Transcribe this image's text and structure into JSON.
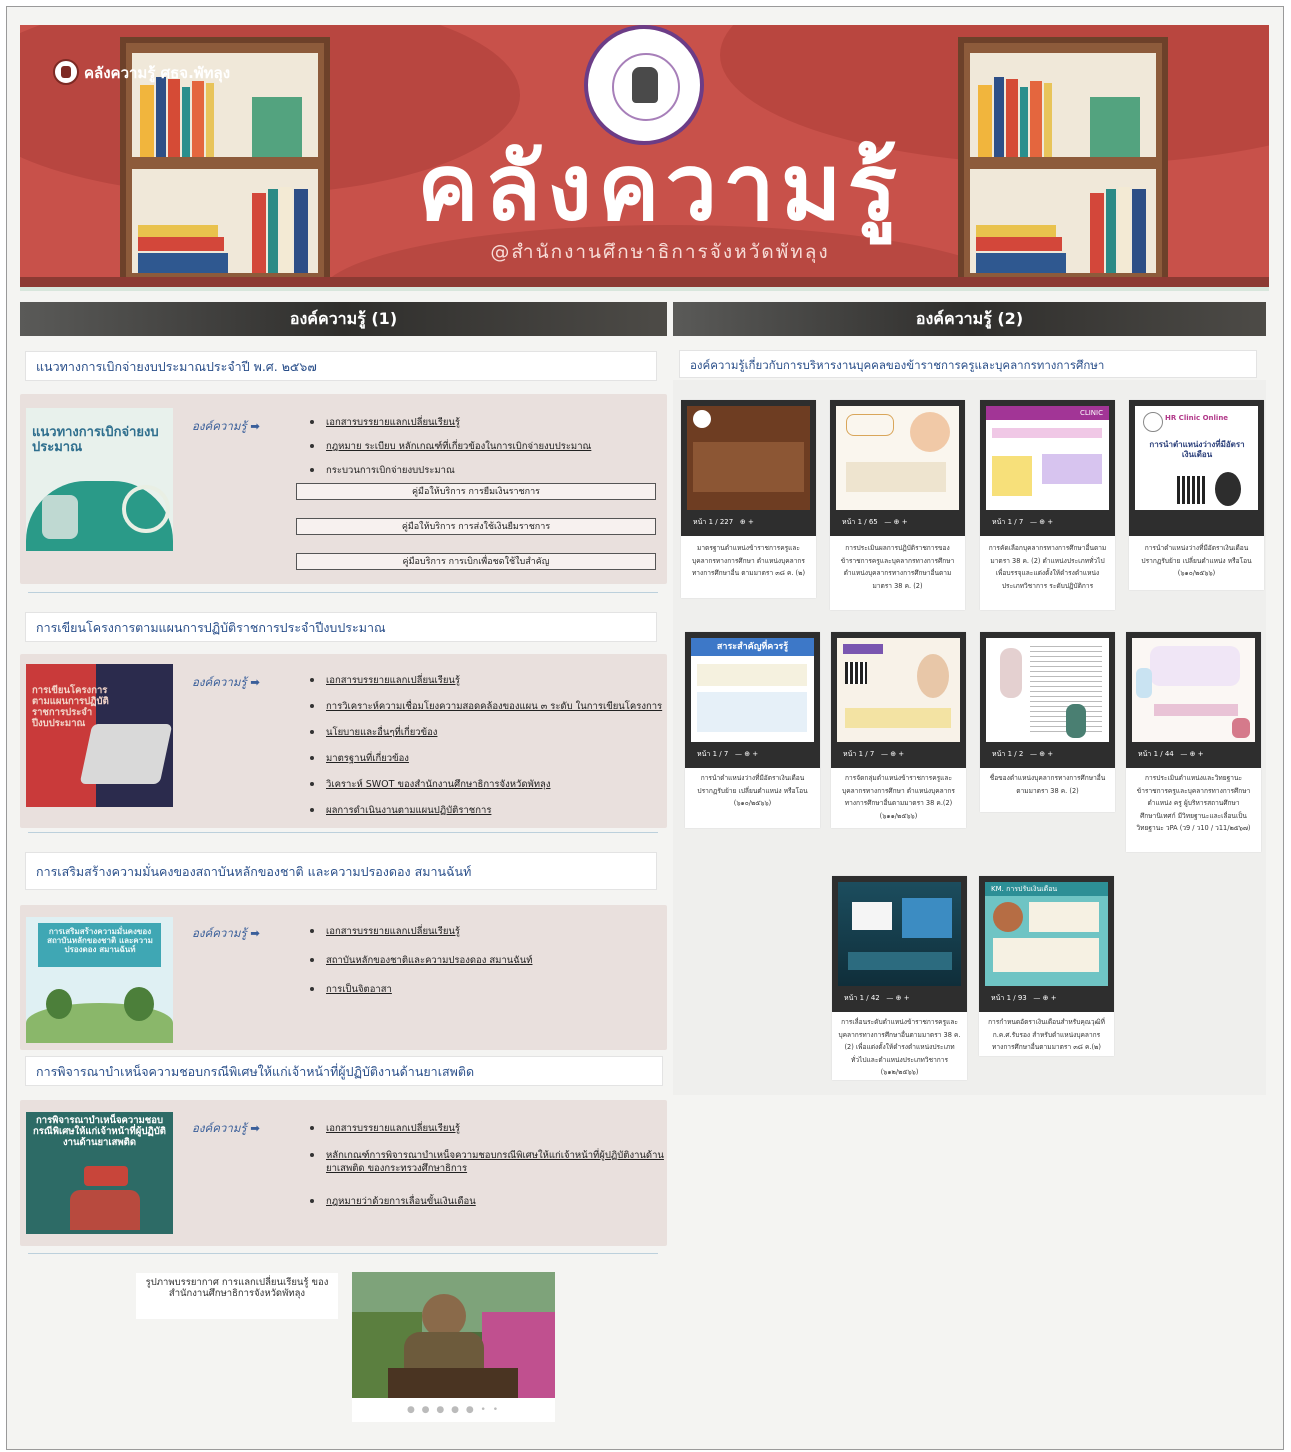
{
  "site_name": "คลังความรู้ ศธจ.พัทลุง",
  "banner": {
    "title": "คลังความรู้",
    "subtitle": "@สำนักงานศึกษาธิการจังหวัดพัทลุง"
  },
  "left_header": "องค์ความรู้ (1)",
  "right_header": "องค์ความรู้ (2)",
  "km_label": "องค์ความรู้",
  "km_arrow": "➡",
  "topics": [
    {
      "title": "แนวทางการเบิกจ่ายงบประมาณประจำปี พ.ศ. ๒๕๖๗",
      "thumb_caption": "แนวทางการเบิกจ่ายงบประมาณ",
      "links": [
        "เอกสารบรรยายแลกเปลี่ยนเรียนรู้",
        "กฎหมาย ระเบียบ หลักเกณฑ์ที่เกี่ยวข้องในการเบิกจ่ายงบประมาณ",
        "กระบวนการเบิกจ่ายงบประมาณ"
      ],
      "boxes": [
        "คู่มือให้บริการ การยืมเงินราชการ",
        "คู่มือให้บริการ การส่งใช้เงินยืมราชการ",
        "คู่มือบริการ การเบิกเพื่อชดใช้ใบสำคัญ"
      ]
    },
    {
      "title": "การเขียนโครงการตามแผนการปฏิบัติราชการประจำปีงบประมาณ",
      "thumb_caption": "การเขียนโครงการ ตามแผนการปฏิบัติราชการประจำปีงบประมาณ",
      "links": [
        "เอกสารบรรยายแลกเปลี่ยนเรียนรู้",
        "การวิเคราะห์ความเชื่อมโยงความสอดคล้องของแผน ๓ ระดับ ในการเขียนโครงการ",
        "นโยบายและอื่นๆที่เกี่ยวข้อง",
        "มาตรฐานที่เกี่ยวข้อง",
        "วิเคราะห์ SWOT ของสำนักงานศึกษาธิการจังหวัดพัทลุง",
        "ผลการดำเนินงานตามแผนปฏิบัติราชการ"
      ]
    },
    {
      "title": "การเสริมสร้างความมั่นคงของสถาบันหลักของชาติ และความปรองดอง สมานฉันท์",
      "thumb_caption": "การเสริมสร้างความมั่นคงของสถาบันหลักของชาติ และความปรองดอง สมานฉันท์",
      "links": [
        "เอกสารบรรยายแลกเปลี่ยนเรียนรู้",
        "สถาบันหลักของชาติและความปรองดอง สมานฉันท์",
        "การเป็นจิตอาสา"
      ]
    },
    {
      "title": "การพิจารณาบำเหน็จความชอบกรณีพิเศษให้แก่เจ้าหน้าที่ผู้ปฏิบัติงานด้านยาเสพติด",
      "thumb_caption": "การพิจารณาบำเหน็จความชอบกรณีพิเศษให้แก่เจ้าหน้าที่ผู้ปฏิบัติงานด้านยาเสพติด",
      "links": [
        "เอกสารบรรยายแลกเปลี่ยนเรียนรู้",
        "หลักเกณฑ์การพิจารณาบำเหน็จความชอบกรณีพิเศษให้แก่เจ้าหน้าที่ผู้ปฏิบัติงานด้านยาเสพติด ของกระทรวงศึกษาธิการ",
        "กฎหมายว่าด้วยการเลื่อนขั้นเงินเดือน"
      ]
    }
  ],
  "right_title": "องค์ความรู้เกี่ยวกับการบริหารงานบุคคลของข้าราชการครูและบุคลากรทางการศึกษา",
  "page_prefix": "หน้า",
  "cards": [
    {
      "page": "1 / 227",
      "caption": "มาตรฐานตำแหน่งข้าราชการครูและบุคลากรทางการศึกษา ตำแหน่งบุคลากรทางการศึกษาอื่น ตามมาตรา ๓๘ ค. (๒)"
    },
    {
      "page": "1 / 65",
      "caption": "การประเมินผลการปฏิบัติราชการของข้าราชการครูและบุคลากรทางการศึกษา ตำแหน่งบุคลากรทางการศึกษาอื่นตามมาตรา 38 ค. (2)"
    },
    {
      "page": "1 / 7",
      "caption": "การคัดเลือกบุคลากรทางการศึกษาอื่นตามมาตรา 38 ค. (2) ตำแหน่งประเภททั่วไปเพื่อบรรจุและแต่งตั้งให้ดำรงตำแหน่งประเภทวิชาการ ระดับปฏิบัติการ"
    },
    {
      "page": "",
      "caption": "การนำตำแหน่งว่างที่มีอัตราเงินเดือนปรากฏรับย้าย เปลี่ยนตำแหน่ง หรือโอน (๖๑๐/๒๕๖๖)"
    },
    {
      "page": "1 / 7",
      "caption": "การนำตำแหน่งว่างที่มีอัตราเงินเดือนปรากฏรับย้าย เปลี่ยนตำแหน่ง หรือโอน (๖๑๐/๒๕๖๖)"
    },
    {
      "page": "1 / 7",
      "caption": "การจัดกลุ่มตำแหน่งข้าราชการครูและบุคลากรทางการศึกษา ตำแหน่งบุคลากรทางการศึกษาอื่นตามมาตรา 38 ค.(2) (๖๑๑/๒๕๖๖)"
    },
    {
      "page": "1 / 2",
      "caption": "ชื่อของตำแหน่งบุคลากรทางการศึกษาอื่นตามมาตรา 38 ค. (2)"
    },
    {
      "page": "1 / 44",
      "caption": "การประเมินตำแหน่งและวิทยฐานะข้าราชการครูและบุคลากรทางการศึกษา ตำแหน่ง ครู ผู้บริหารสถานศึกษา ศึกษานิเทศก์ มีวิทยฐานะและเลื่อนเป็นวิทยฐานะ วPA (ว9 / ว10 / ว11/๒๕๖๗)"
    },
    {
      "page": "1 / 42",
      "caption": "การเลื่อนระดับตำแหน่งข้าราชการครูและบุคลากรทางการศึกษาอื่นตามมาตรา 38 ค.(2) เพื่อแต่งตั้งให้ดำรงตำแหน่งประเภททั่วไปและตำแหน่งประเภทวิชาการ (๖๑๒/๒๕๖๖)"
    },
    {
      "page": "1 / 93",
      "caption": "การกำหนดอัตราเงินเดือนสำหรับคุณวุฒิที่ ก.ค.ศ.รับรอง สำหรับตำแหน่งบุคลากรทางการศึกษาอื่นตามมาตรา ๓๘ ค.(๒)"
    }
  ],
  "card_headers": {
    "c4_brand": "HR Clinic Online",
    "c4_title": "การนำตำแหน่งว่างที่มีอัตราเงินเดือน",
    "c5_title": "สาระสำคัญที่ควรรู้",
    "c10_title": "KM. การปรับเงินเดือน",
    "c3_title": "CLINIC"
  },
  "gallery": {
    "label": "รูปภาพบรรยากาศ การแลกเปลี่ยนเรียนรู้ ของสำนักงานศึกษาธิการจังหวัดพัทลุง",
    "dots": "● ● ● ● ● • •"
  },
  "colors": {
    "banner": "#c8514a",
    "link_blue": "#2a4f8a",
    "panel": "#e9e0dd"
  }
}
